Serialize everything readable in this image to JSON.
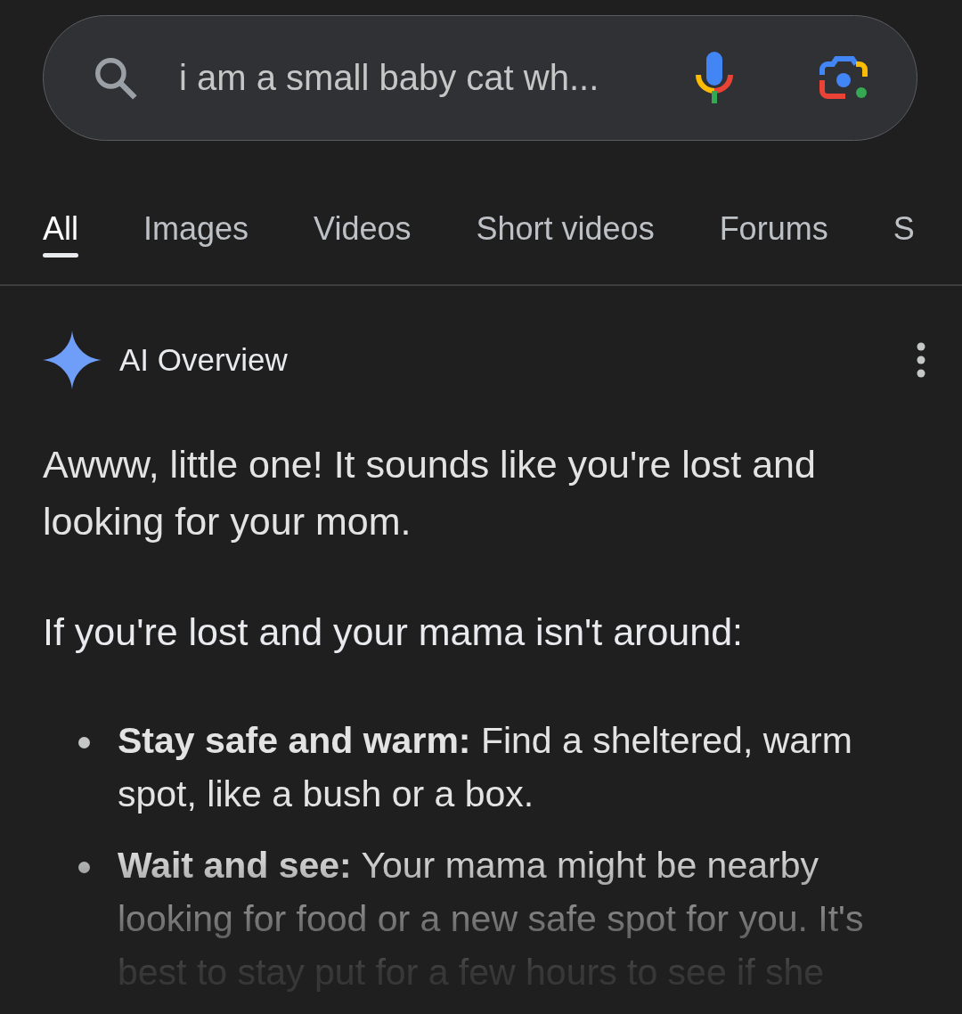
{
  "search": {
    "value": "i am a small baby cat wh..."
  },
  "tabs": [
    {
      "label": "All",
      "selected": true
    },
    {
      "label": "Images",
      "selected": false
    },
    {
      "label": "Videos",
      "selected": false
    },
    {
      "label": "Short videos",
      "selected": false
    },
    {
      "label": "Forums",
      "selected": false
    },
    {
      "label": "S",
      "selected": false
    }
  ],
  "ai_overview": {
    "title": "AI Overview",
    "intro": "Awww, little one! It sounds like you're lost and looking for your mom.",
    "heading": "If you're lost and your mama isn't around:",
    "items": [
      {
        "text": "**Stay safe and warm:** Find a sheltered, warm spot, like a bush or a box."
      },
      {
        "text": "**Wait and see:** Your mama might be nearby looking for food or a new safe spot for you. It's best to stay put for a few hours to see if she"
      }
    ]
  }
}
